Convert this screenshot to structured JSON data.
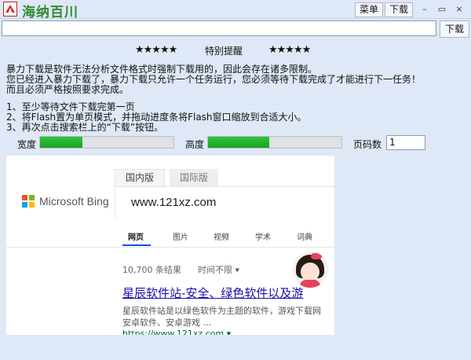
{
  "app": {
    "title": "海纳百川",
    "icon": "pdf-icon"
  },
  "toolbar": {
    "menu_label": "菜单",
    "download_label": "下载"
  },
  "window_controls": {
    "minimize": "–",
    "restore": "▭",
    "close": "×"
  },
  "url_bar": {
    "value": "",
    "button_label": "下载"
  },
  "notice": {
    "stars_left": "★★★★★",
    "title": "特别提醒",
    "stars_right": "★★★★★",
    "lines": [
      "暴力下载是软件无法分析文件格式时强制下载用的，因此会存在诸多限制。",
      "您已经进入暴力下载了，暴力下载只允许一个任务运行，您必须等待下载完成了才能进行下一任务！",
      "而且必须严格按照要求完成。"
    ],
    "steps": [
      "1、至少等待文件下载完第一页",
      "2、将Flash置为单页模式，并拖动进度条将Flash窗口缩放到合适大小。",
      "3、再次点击搜索栏上的“下载”按钮。"
    ]
  },
  "controls": {
    "width_label": "宽度",
    "width_progress": 0.32,
    "height_label": "高度",
    "height_progress": 0.46,
    "pages_label": "页码数",
    "pages_value": "1"
  },
  "preview": {
    "brand": "Microsoft Bing",
    "tabs": [
      "国内版",
      "国际版"
    ],
    "query": "www.121xz.com",
    "result_tabs": [
      "网页",
      "图片",
      "视频",
      "学术",
      "词典"
    ],
    "result_count": "10,700 条结果",
    "time_filter": "时间不限 ▾",
    "result_title": "星辰软件站-安全、绿色软件以及游",
    "result_desc_1": "星辰软件站是以绿色软件为主题的软件，游戏下载网",
    "result_desc_2": "安卓软件、安卓游戏 ...",
    "result_url": "https://www.121xz.com ▾"
  },
  "colors": {
    "accent_green": "#1fa82a",
    "link_blue": "#1a0dab",
    "title_green": "#2e8b2e"
  }
}
